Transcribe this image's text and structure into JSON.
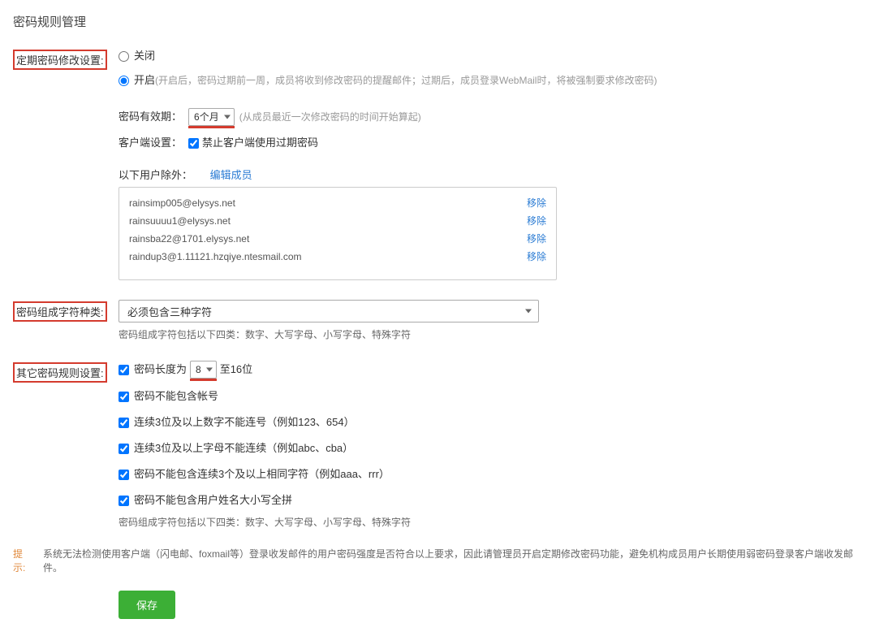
{
  "page_title": "密码规则管理",
  "section1": {
    "label": "定期密码修改设置:",
    "radio_off": "关闭",
    "radio_on": "开启",
    "radio_on_note": "(开启后，密码过期前一周，成员将收到修改密码的提醒邮件；过期后，成员登录WebMail时，将被强制要求修改密码)",
    "expire_label": "密码有效期：",
    "expire_value": "6个月",
    "expire_note": "(从成员最近一次修改密码的时间开始算起)",
    "client_label": "客户端设置：",
    "client_checkbox": "禁止客户端使用过期密码",
    "except_label": "以下用户除外：",
    "edit_members": "编辑成员",
    "users": [
      "rainsimp005@elysys.net",
      "rainsuuuu1@elysys.net",
      "rainsba22@1701.elysys.net",
      "raindup3@1.11121.hzqiye.ntesmail.com"
    ],
    "remove_label": "移除"
  },
  "section2": {
    "label": "密码组成字符种类:",
    "select_value": "必须包含三种字符",
    "hint": "密码组成字符包括以下四类：数字、大写字母、小写字母、特殊字符"
  },
  "section3": {
    "label": "其它密码规则设置:",
    "rule_len_prefix": "密码长度为",
    "rule_len_value": "8",
    "rule_len_suffix": "至16位",
    "rule_no_account": "密码不能包含帐号",
    "rule_no_seq_num": "连续3位及以上数字不能连号（例如123、654）",
    "rule_no_seq_alpha": "连续3位及以上字母不能连续（例如abc、cba）",
    "rule_no_repeat": "密码不能包含连续3个及以上相同字符（例如aaa、rrr）",
    "rule_no_name": "密码不能包含用户姓名大小写全拼",
    "hint": "密码组成字符包括以下四类：数字、大写字母、小写字母、特殊字符"
  },
  "tip": {
    "label": "提示:",
    "text": "系统无法检测使用客户端（闪电邮、foxmail等）登录收发邮件的用户密码强度是否符合以上要求，因此请管理员开启定期修改密码功能，避免机构成员用户长期使用弱密码登录客户端收发邮件。"
  },
  "save_btn": "保存"
}
